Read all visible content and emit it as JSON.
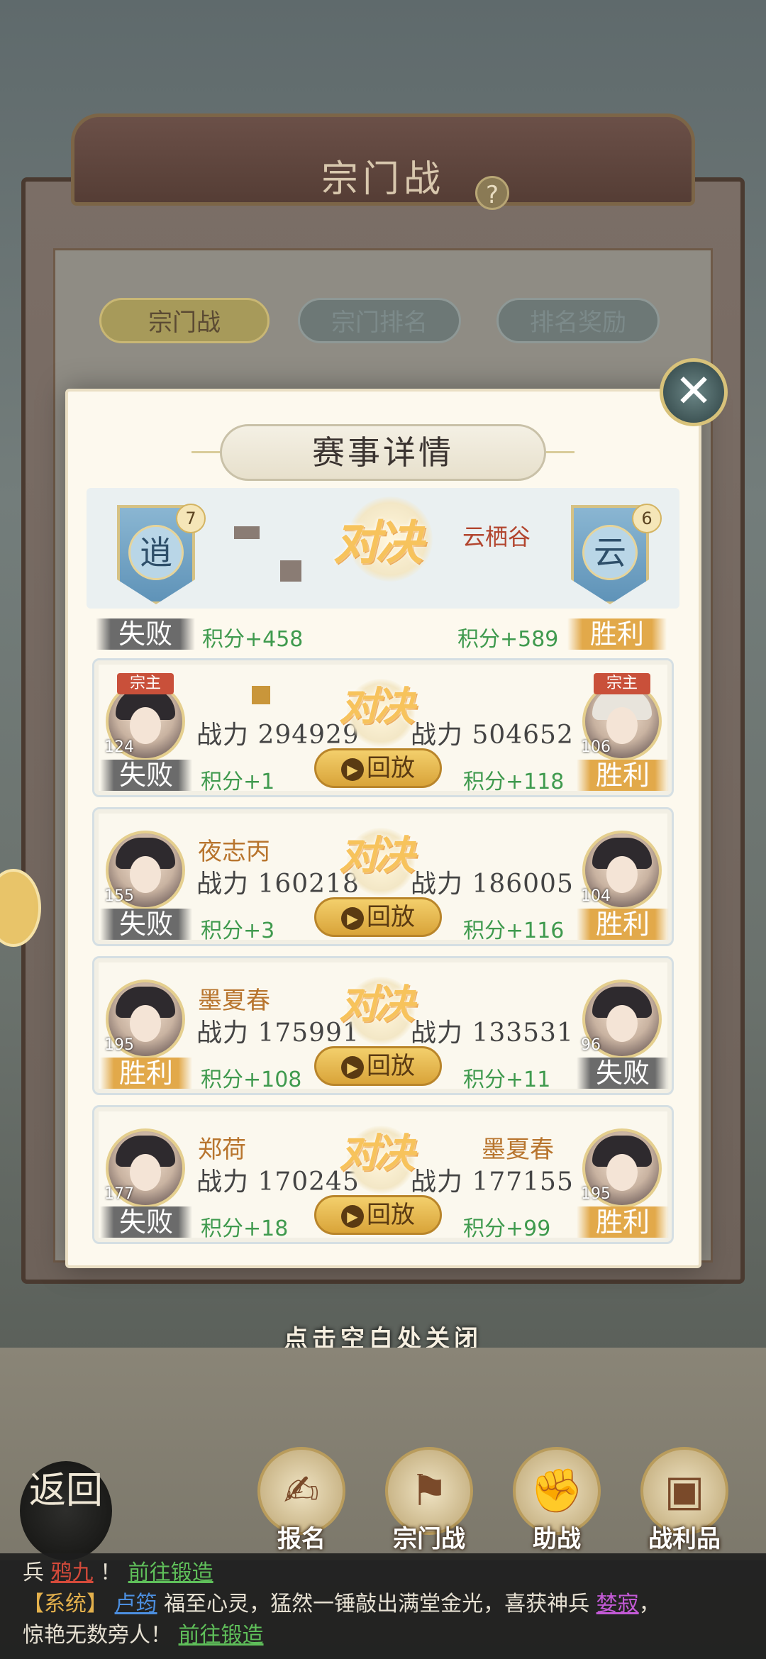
{
  "header": {
    "title": "宗门战",
    "tabs": [
      "宗门战",
      "宗门排名",
      "排名奖励"
    ]
  },
  "modal": {
    "title": "赛事详情",
    "close_hint": "点击空白处关闭"
  },
  "matchup": {
    "left": {
      "banner_char": "逍",
      "badge": "7",
      "result": "失败",
      "score": "积分+458"
    },
    "right": {
      "banner_char": "云",
      "badge": "6",
      "name": "云栖谷",
      "result": "胜利",
      "score": "积分+589"
    },
    "vs": "对决"
  },
  "matches": [
    {
      "left": {
        "leader": "宗主",
        "level": "124",
        "name": "",
        "power": "战力 294929",
        "result": "失败",
        "score": "积分+1"
      },
      "right": {
        "leader": "宗主",
        "level": "106",
        "name": "",
        "power": "战力 504652",
        "result": "胜利",
        "score": "积分+118"
      },
      "vs": "对决",
      "replay": "回放"
    },
    {
      "left": {
        "level": "155",
        "name": "夜志丙",
        "power": "战力 160218",
        "result": "失败",
        "score": "积分+3"
      },
      "right": {
        "level": "104",
        "name": "",
        "power": "战力 186005",
        "result": "胜利",
        "score": "积分+116"
      },
      "vs": "对决",
      "replay": "回放"
    },
    {
      "left": {
        "level": "195",
        "name": "墨夏春",
        "power": "战力 175991",
        "result": "胜利",
        "score": "积分+108"
      },
      "right": {
        "level": "96",
        "name": "",
        "power": "战力 133531",
        "result": "失败",
        "score": "积分+11"
      },
      "vs": "对决",
      "replay": "回放"
    },
    {
      "left": {
        "level": "177",
        "name": "郑荷",
        "power": "战力 170245",
        "result": "失败",
        "score": "积分+18"
      },
      "right": {
        "level": "195",
        "name": "墨夏春",
        "power": "战力 177155",
        "result": "胜利",
        "score": "积分+99"
      },
      "vs": "对决",
      "replay": "回放"
    }
  ],
  "bottom_nav": {
    "back": "返回",
    "items": [
      {
        "label": "报名",
        "icon": "scroll-brush-icon"
      },
      {
        "label": "宗门战",
        "icon": "mountain-flag-icon"
      },
      {
        "label": "助战",
        "icon": "handshake-icon"
      },
      {
        "label": "战利品",
        "icon": "treasure-chest-icon"
      }
    ]
  },
  "chat": {
    "line1_prefix": "兵",
    "line1_link_name": "鸦九",
    "line1_mid": "！",
    "line1_link_action": "前往锻造",
    "line2_tag": "【系统】",
    "line2_link_player": "卢筠",
    "line2_text": "福至心灵，猛然一锤敲出满堂金光，喜获神兵",
    "line2_link_item": "婪寂",
    "line2_end": "，",
    "line3_text": "惊艳无数旁人！",
    "line3_link_action": "前往锻造"
  },
  "colors": {
    "win": "#e2a94a",
    "lose": "#6b6b6b",
    "score_green": "#3f9a4e",
    "team_name_red": "#b2452e",
    "player_name_gold": "#b8752e"
  }
}
